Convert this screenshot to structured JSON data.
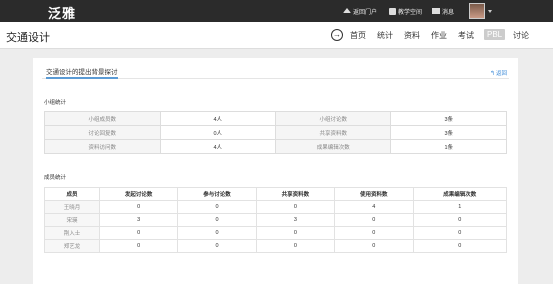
{
  "app": {
    "logo": "泛雅"
  },
  "topnav": {
    "portal": "返回门户",
    "space": "教学空间",
    "messages": "消息"
  },
  "course": {
    "title": "交通设计"
  },
  "menu": [
    "首页",
    "统计",
    "资料",
    "作业",
    "考试",
    "PBL",
    "讨论"
  ],
  "active_menu": "PBL",
  "card": {
    "tab": "交通设计的提出背景探讨",
    "back": "返回"
  },
  "group_stats": {
    "title": "小组统计",
    "rows": [
      [
        "小组成员数",
        "4人",
        "小组讨论数",
        "3条"
      ],
      [
        "讨论回复数",
        "0人",
        "共享资料数",
        "3条"
      ],
      [
        "资料访问数",
        "4人",
        "成果编辑次数",
        "1条"
      ]
    ]
  },
  "member_stats": {
    "title": "成员统计",
    "headers": [
      "成员",
      "发起讨论数",
      "参与讨论数",
      "共享资料数",
      "使用资料数",
      "成果编辑次数"
    ],
    "rows": [
      [
        "王晓月",
        "0",
        "0",
        "0",
        "4",
        "1"
      ],
      [
        "宋瑛",
        "3",
        "0",
        "3",
        "0",
        "0"
      ],
      [
        "荆入士",
        "0",
        "0",
        "0",
        "0",
        "0"
      ],
      [
        "郑艺龙",
        "0",
        "0",
        "0",
        "0",
        "0"
      ]
    ]
  }
}
